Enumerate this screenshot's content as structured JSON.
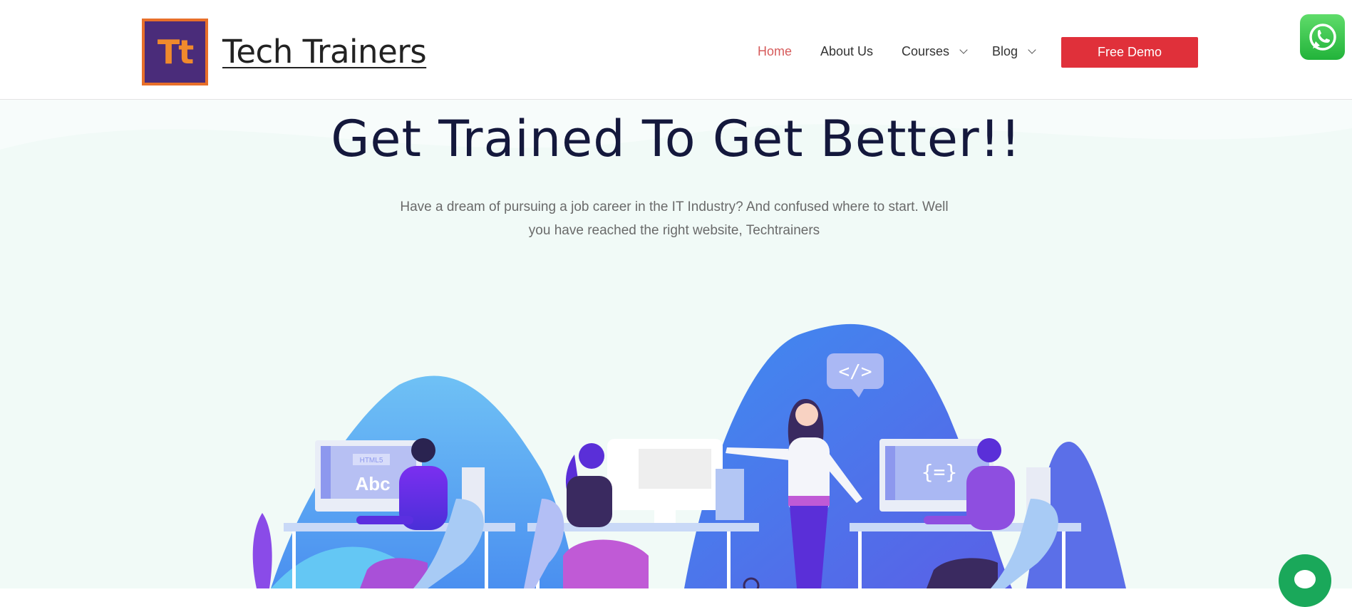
{
  "header": {
    "logo_text": "Tt",
    "brand_name": "Tech Trainers",
    "nav": [
      {
        "label": "Home",
        "active": true,
        "dropdown": false
      },
      {
        "label": "About Us",
        "active": false,
        "dropdown": false
      },
      {
        "label": "Courses",
        "active": false,
        "dropdown": true
      },
      {
        "label": "Blog",
        "active": false,
        "dropdown": true
      }
    ],
    "cta_label": "Free Demo"
  },
  "hero": {
    "title": "Get Trained To Get Better!!",
    "subtitle": "Have a dream of pursuing a job career in the IT Industry? And confused where to start. Well you have reached the right website, Techtrainers"
  },
  "illustration": {
    "screen_1_tag": "HTML5",
    "screen_1_text": "Abc",
    "code_bubble": "</>",
    "screen_3_text": "{=}"
  },
  "colors": {
    "accent": "#e0303a",
    "nav_active": "#d65b5b",
    "title": "#14183c",
    "whatsapp": "#25d366",
    "chat": "#1aa85a"
  },
  "icons": {
    "whatsapp": "whatsapp-icon",
    "chat": "chat-icon"
  }
}
